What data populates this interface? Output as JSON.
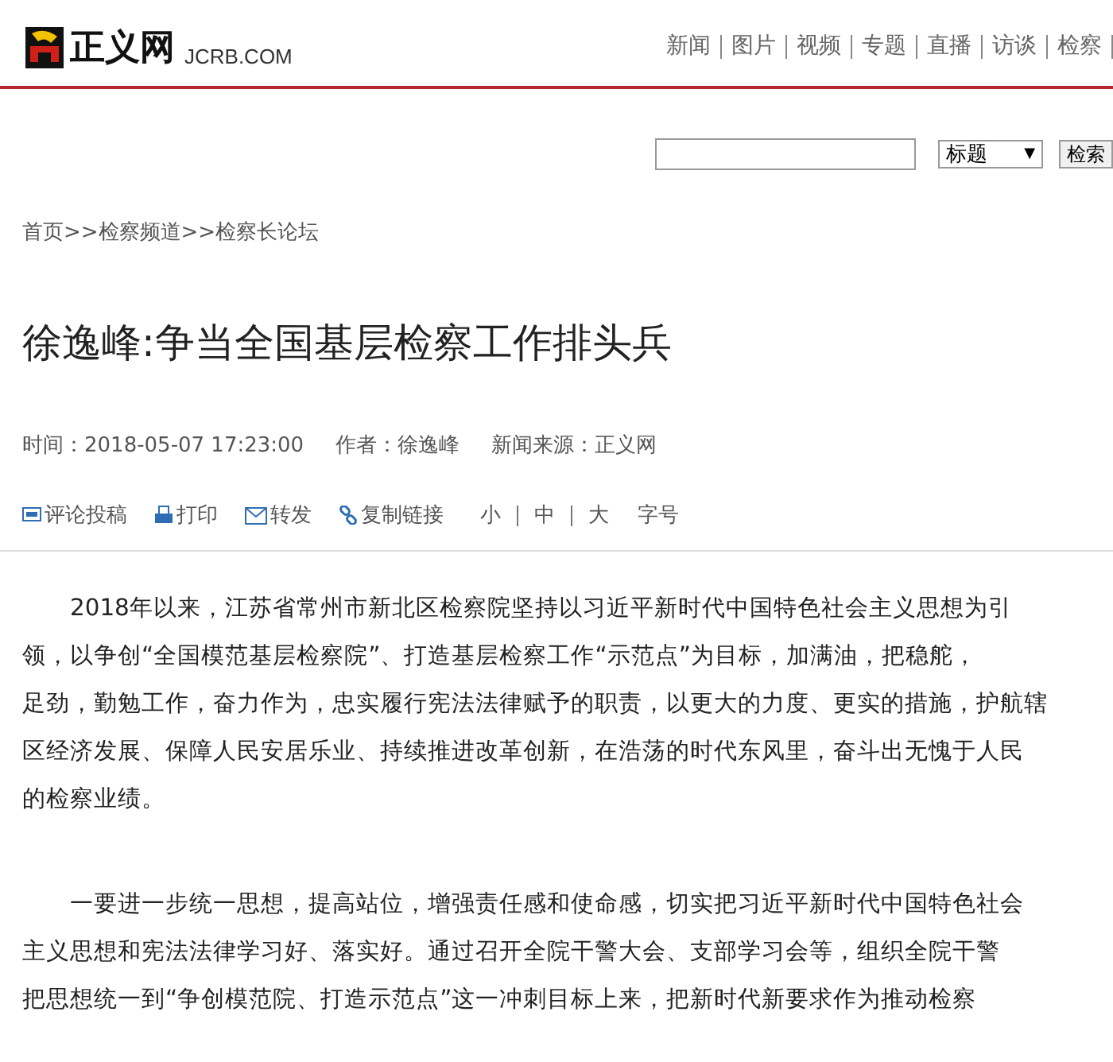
{
  "logo": {
    "name": "正义网",
    "domain": "JCRB.COM"
  },
  "nav": [
    "新闻",
    "图片",
    "视频",
    "专题",
    "直播",
    "访谈",
    "检察"
  ],
  "search": {
    "select": "标题",
    "select_arrow": "▼",
    "button": "检索"
  },
  "breadcrumb": "首页>>检察频道>>检察长论坛",
  "title": "徐逸峰:争当全国基层检察工作排头兵",
  "meta": [
    "时间：2018-05-07 17:23:00",
    "作者：徐逸峰",
    "新闻来源：正义网"
  ],
  "tools": [
    {
      "kind": "comment",
      "label": "评论投稿"
    },
    {
      "kind": "print",
      "label": "打印"
    },
    {
      "kind": "mail",
      "label": "转发"
    },
    {
      "kind": "link",
      "label": "复制链接"
    }
  ],
  "font_sizes": [
    "小",
    "中",
    "大"
  ],
  "font_size_label": "字号",
  "paragraphs": [
    [
      "2018年以来，江苏省常州市新北区检察院坚持以习近平新时代中国特色社会主义思想为引",
      "领，以争创“全国模范基层检察院”、打造基层检察工作“示范点”为目标，加满油，把稳舵，",
      "足劲，勤勉工作，奋力作为，忠实履行宪法法律赋予的职责，以更大的力度、更实的措施，护航辖",
      "区经济发展、保障人民安居乐业、持续推进改革创新，在浩荡的时代东风里，奋斗出无愧于人民",
      "的检察业绩。"
    ],
    [
      "一要进一步统一思想，提高站位，增强责任感和使命感，切实把习近平新时代中国特色社会",
      "主义思想和宪法法律学习好、落实好。通过召开全院干警大会、支部学习会等，组织全院干警",
      "把思想统一到“争创模范院、打造示范点”这一冲刺目标上来，把新时代新要求作为推动检察"
    ]
  ]
}
